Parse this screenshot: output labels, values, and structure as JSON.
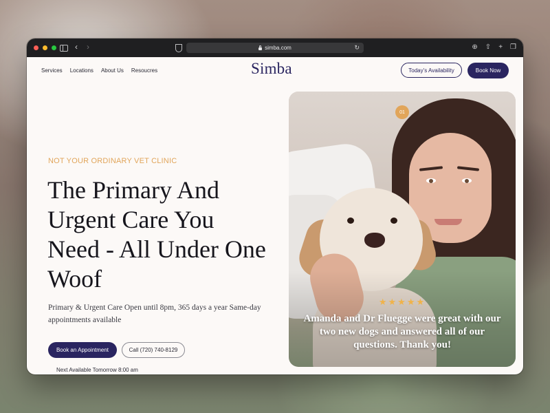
{
  "browser": {
    "url": "simba.com",
    "icons": [
      "sidebar-icon",
      "back-icon",
      "forward-icon",
      "shield-icon",
      "lock-icon",
      "reload-icon",
      "download-icon",
      "share-icon",
      "new-tab-icon",
      "tabs-icon"
    ]
  },
  "nav": {
    "links": [
      "Services",
      "Locations",
      "About Us",
      "Resoucres"
    ],
    "logo": "Simba",
    "availability_button": "Today’s Availability",
    "book_button": "Book Now"
  },
  "hero": {
    "eyebrow": "NOT YOUR ORDINARY VET CLINIC",
    "headline": "The Primary And Urgent Care You Need - All Under One Woof",
    "subtext": "Primary & Urgent Care Open until 8pm, 365 days a year Same-day appointments available",
    "cta_primary": "Book an Appointment",
    "cta_secondary": "Call (720) 740-8129",
    "next_available": "Next Available Tomorrow 8:00 am"
  },
  "testimonial": {
    "slide_number": "01",
    "stars": "★★★★★",
    "rating": 5,
    "quote": "Amanda and Dr Fluegge were great with our two new dogs and answered all of our questions. Thank you!"
  },
  "colors": {
    "brand": "#2a2560",
    "accent": "#e1a55a",
    "page_bg": "#fcf9f7"
  }
}
